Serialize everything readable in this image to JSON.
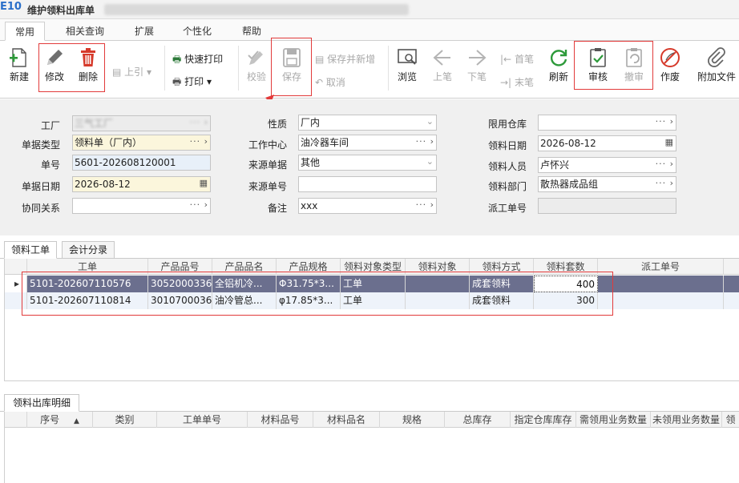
{
  "window": {
    "logo": "E10",
    "title": "维护领料出库单",
    "title_blurred": "【测试数据 DL2014 0301 三气阀门有限 工厂 0301 烘干 2012 全部数据】"
  },
  "menu": {
    "tabs": [
      "常用",
      "相关查询",
      "扩展",
      "个性化",
      "帮助"
    ],
    "active": "常用"
  },
  "toolbar": {
    "new": "新建",
    "edit": "修改",
    "delete": "删除",
    "import": "上引",
    "quick_print": "快速打印",
    "print": "打印",
    "verify": "校验",
    "save": "保存",
    "save_new": "保存并新增",
    "cancel": "取消",
    "browse": "浏览",
    "prev": "上笔",
    "next": "下笔",
    "first": "首笔",
    "last": "末笔",
    "refresh": "刷新",
    "approve": "审核",
    "unapprove": "撤审",
    "void": "作废",
    "attach": "附加文件"
  },
  "form": {
    "factory_label": "工厂",
    "factory_value": "三气工厂",
    "doc_type_label": "单据类型",
    "doc_type_value": "领料单（厂内）",
    "doc_no_label": "单号",
    "doc_no_value": "5601-202608120001",
    "doc_date_label": "单据日期",
    "doc_date_value": "2026-08-12",
    "collab_label": "协同关系",
    "collab_value": "",
    "nature_label": "性质",
    "nature_value": "厂内",
    "workcenter_label": "工作中心",
    "workcenter_value": "油冷器车间",
    "src_doc_label": "来源单据",
    "src_doc_value": "其他",
    "src_no_label": "来源单号",
    "src_no_value": "",
    "remark_label": "备注",
    "remark_value": "xxx",
    "limit_wh_label": "限用仓库",
    "limit_wh_value": "",
    "pick_date_label": "领料日期",
    "pick_date_value": "2026-08-12",
    "picker_label": "领料人员",
    "picker_value": "卢怀兴",
    "pick_dept_label": "领料部门",
    "pick_dept_value": "散热器成品组",
    "dispatch_label": "派工单号",
    "dispatch_value": ""
  },
  "tabs_top": [
    "领料工单",
    "会计分录"
  ],
  "grid1": {
    "headers": [
      "工单",
      "产品品号",
      "产品品名",
      "产品规格",
      "领料对象类型",
      "领料对象",
      "领料方式",
      "领料套数",
      "派工单号"
    ],
    "rows": [
      {
        "wo": "5101-202607110576",
        "item": "3052000336",
        "name": "全铝机冷...",
        "spec": "Φ31.75*3...",
        "obj_type": "工单",
        "obj": "",
        "method": "成套领料",
        "qty": "400",
        "dispatch": ""
      },
      {
        "wo": "5101-202607110814",
        "item": "3010700036",
        "name": "油冷管总...",
        "spec": "φ17.85*3...",
        "obj_type": "工单",
        "obj": "",
        "method": "成套领料",
        "qty": "300",
        "dispatch": ""
      }
    ]
  },
  "tabs_bottom": [
    "领料出库明细"
  ],
  "grid2": {
    "headers": [
      "序号",
      "类别",
      "工单单号",
      "材料品号",
      "材料品名",
      "规格",
      "总库存",
      "指定仓库库存",
      "需领用业务数量",
      "未领用业务数量",
      "领料"
    ]
  },
  "colors": {
    "highlight": "#e23b3b",
    "selected_row": "#6b6f8e",
    "required_field": "#fbf6dc"
  }
}
